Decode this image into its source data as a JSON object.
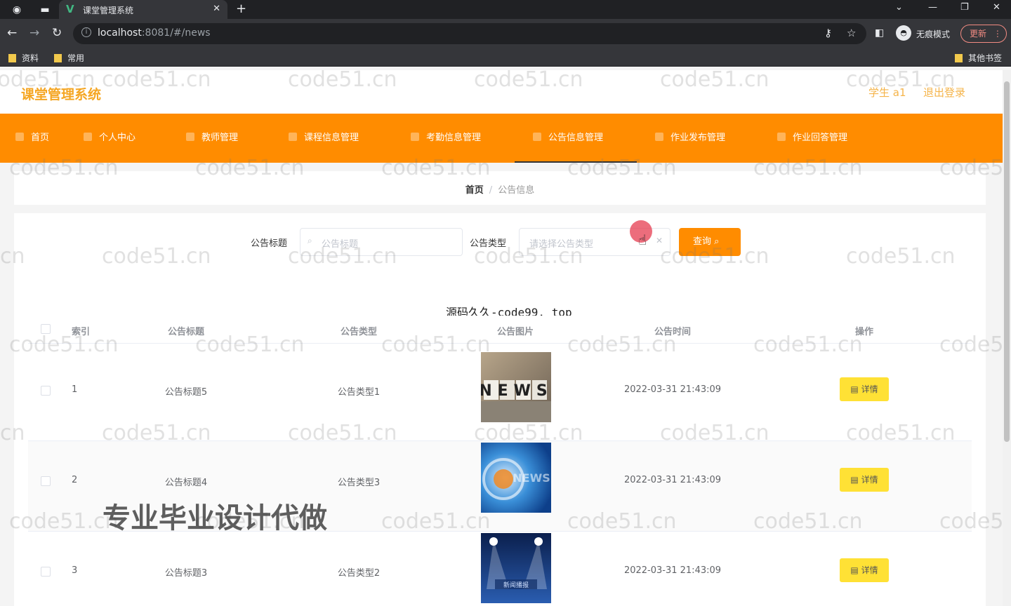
{
  "browser": {
    "tab_title": "课堂管理系统",
    "url_host": "localhost",
    "url_rest": ":8081/#/news",
    "incognito_label": "无痕模式",
    "update_label": "更新",
    "bookmarks": [
      "资料",
      "常用"
    ],
    "other_bookmarks": "其他书签"
  },
  "header": {
    "title": "课堂管理系统",
    "user": "学生 a1",
    "logout": "退出登录"
  },
  "nav": {
    "items": [
      "首页",
      "个人中心",
      "教师管理",
      "课程信息管理",
      "考勤信息管理",
      "公告信息管理",
      "作业发布管理",
      "作业回答管理"
    ],
    "active": "公告信息管理"
  },
  "breadcrumb": {
    "home": "首页",
    "sep": "/",
    "current": "公告信息"
  },
  "search": {
    "title_label": "公告标题",
    "title_placeholder": "公告标题",
    "type_label": "公告类型",
    "type_placeholder": "请选择公告类型",
    "query_label": "查询"
  },
  "overlay_text": "源码久久-code99. top",
  "table": {
    "columns": [
      "索引",
      "公告标题",
      "公告类型",
      "公告图片",
      "公告时间",
      "操作"
    ],
    "rows": [
      {
        "index": "1",
        "title": "公告标题5",
        "type": "公告类型1",
        "image": "NEWS",
        "time": "2022-03-31 21:43:09",
        "action": "详情"
      },
      {
        "index": "2",
        "title": "公告标题4",
        "type": "公告类型3",
        "image": "NEWS",
        "time": "2022-03-31 21:43:09",
        "action": "详情"
      },
      {
        "index": "3",
        "title": "公告标题3",
        "type": "公告类型2",
        "image": "新闻播报",
        "time": "2022-03-31 21:43:09",
        "action": "详情"
      }
    ]
  },
  "watermark": "code51.cn",
  "promo": "专业毕业设计代做"
}
